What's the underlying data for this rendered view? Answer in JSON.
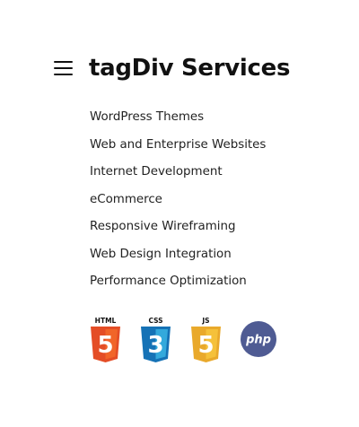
{
  "header": {
    "title": "tagDiv Services",
    "menu_icon": "hamburger-menu-icon"
  },
  "services": [
    "WordPress Themes",
    "Web and Enterprise Websites",
    "Internet Development",
    "eCommerce",
    "Responsive Wireframing",
    "Web Design Integration",
    "Performance Optimization"
  ],
  "tech_logos": {
    "html5": {
      "label": "HTML",
      "numeral": "5",
      "color": "#e44d26",
      "shade": "#f16529"
    },
    "css3": {
      "label": "CSS",
      "numeral": "3",
      "color": "#1572b6",
      "shade": "#33a9dc"
    },
    "js": {
      "label": "JS",
      "numeral": "5",
      "color": "#e9a92b",
      "shade": "#f5c13a"
    },
    "php": {
      "label": "php",
      "color": "#4f5b93"
    }
  }
}
